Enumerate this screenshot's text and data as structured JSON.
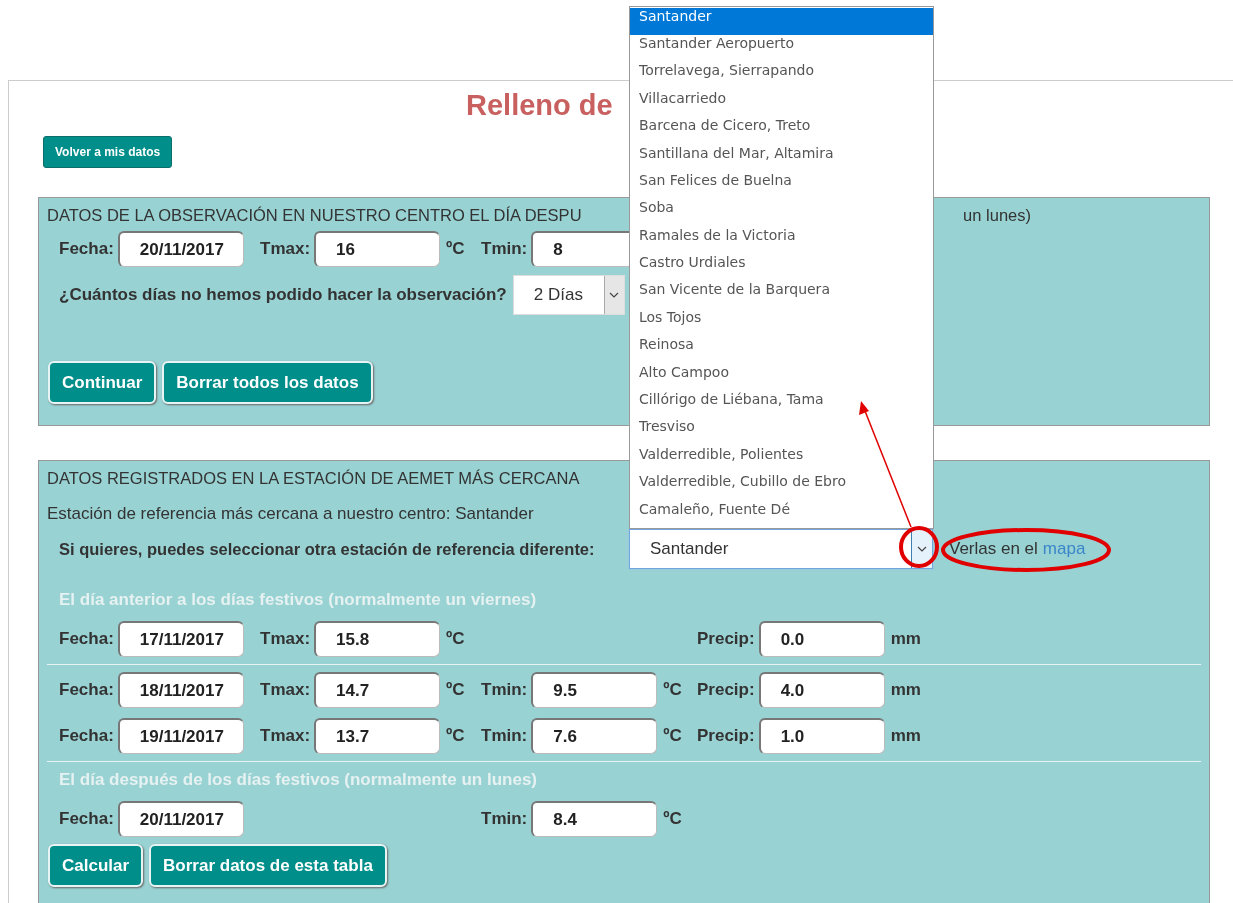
{
  "title": "Relleno de",
  "back_button": "Volver a mis datos",
  "observation_panel": {
    "heading_parts": [
      "DATOS DE LA OBSERVACIÓN EN NUESTRO CENTRO EL DÍA DESPU",
      "un lunes)"
    ],
    "fields": [
      {
        "kind": "fecha",
        "label": "Fecha:",
        "value": "20/11/2017"
      },
      {
        "kind": "tmax",
        "label": "Tmax:",
        "value": "16",
        "unit": "ºC"
      },
      {
        "kind": "tmin",
        "label": "Tmin:",
        "value": "8"
      }
    ],
    "question": "¿Cuántos días no hemos podido hacer la observación?",
    "days_select": {
      "value": "2 Días"
    },
    "buttons": [
      "Continuar",
      "Borrar todos los datos"
    ]
  },
  "station_panel": {
    "heading": "DATOS REGISTRADOS EN LA ESTACIÓN DE AEMET MÁS CERCANA",
    "nearest_station": "Estación de referencia más cercana a nuestro centro: Santander",
    "select_label": "Si quieres, puedes seleccionar otra estación de referencia diferente:",
    "station_select": {
      "value": "Santander",
      "expanded": true,
      "options": [
        {
          "label": "Santander",
          "selected": true
        },
        {
          "label": "Santander Aeropuerto",
          "selected": false
        },
        {
          "label": "Torrelavega, Sierrapando",
          "selected": false
        },
        {
          "label": "Villacarriedo",
          "selected": false
        },
        {
          "label": "Barcena de Cicero, Treto",
          "selected": false
        },
        {
          "label": "Santillana del Mar, Altamira",
          "selected": false
        },
        {
          "label": "San Felices de Buelna",
          "selected": false
        },
        {
          "label": "Soba",
          "selected": false
        },
        {
          "label": "Ramales de la Victoria",
          "selected": false
        },
        {
          "label": "Castro Urdiales",
          "selected": false
        },
        {
          "label": "San Vicente de la Barquera",
          "selected": false
        },
        {
          "label": "Los Tojos",
          "selected": false
        },
        {
          "label": "Reinosa",
          "selected": false
        },
        {
          "label": "Alto Campoo",
          "selected": false
        },
        {
          "label": "Cillórigo de Liébana, Tama",
          "selected": false
        },
        {
          "label": "Tresviso",
          "selected": false
        },
        {
          "label": "Valderredible, Polientes",
          "selected": false
        },
        {
          "label": "Valderredible, Cubillo de Ebro",
          "selected": false
        },
        {
          "label": "Camaleño, Fuente Dé",
          "selected": false
        }
      ]
    },
    "map_link": {
      "text": "Verlas en el",
      "link": "mapa"
    },
    "sections": [
      {
        "kind": "subheading",
        "text": "El día anterior a los días festivos (normalmente un viernes)"
      },
      {
        "kind": "row",
        "fields": [
          {
            "kind": "fecha",
            "label": "Fecha:",
            "value": "17/11/2017"
          },
          {
            "kind": "tmax",
            "label": "Tmax:",
            "value": "15.8",
            "unit": "ºC"
          },
          {
            "kind": "precip",
            "label": "Precip:",
            "value": "0.0",
            "unit": "mm"
          }
        ]
      },
      {
        "kind": "divider"
      },
      {
        "kind": "row",
        "fields": [
          {
            "kind": "fecha",
            "label": "Fecha:",
            "value": "18/11/2017"
          },
          {
            "kind": "tmax",
            "label": "Tmax:",
            "value": "14.7",
            "unit": "ºC"
          },
          {
            "kind": "tmin",
            "label": "Tmin:",
            "value": "9.5",
            "unit": "ºC"
          },
          {
            "kind": "precip",
            "label": "Precip:",
            "value": "4.0",
            "unit": "mm"
          }
        ]
      },
      {
        "kind": "row",
        "fields": [
          {
            "kind": "fecha",
            "label": "Fecha:",
            "value": "19/11/2017"
          },
          {
            "kind": "tmax",
            "label": "Tmax:",
            "value": "13.7",
            "unit": "ºC"
          },
          {
            "kind": "tmin",
            "label": "Tmin:",
            "value": "7.6",
            "unit": "ºC"
          },
          {
            "kind": "precip",
            "label": "Precip:",
            "value": "1.0",
            "unit": "mm"
          }
        ]
      },
      {
        "kind": "divider"
      },
      {
        "kind": "subheading",
        "text": "El día después de los días festivos (normalmente un lunes)"
      },
      {
        "kind": "row",
        "fields": [
          {
            "kind": "fecha",
            "label": "Fecha:",
            "value": "20/11/2017"
          },
          {
            "kind": "tmin",
            "label": "Tmin:",
            "value": "8.4",
            "unit": "ºC"
          }
        ]
      }
    ],
    "buttons": [
      "Calcular",
      "Borrar datos de esta tabla"
    ]
  }
}
